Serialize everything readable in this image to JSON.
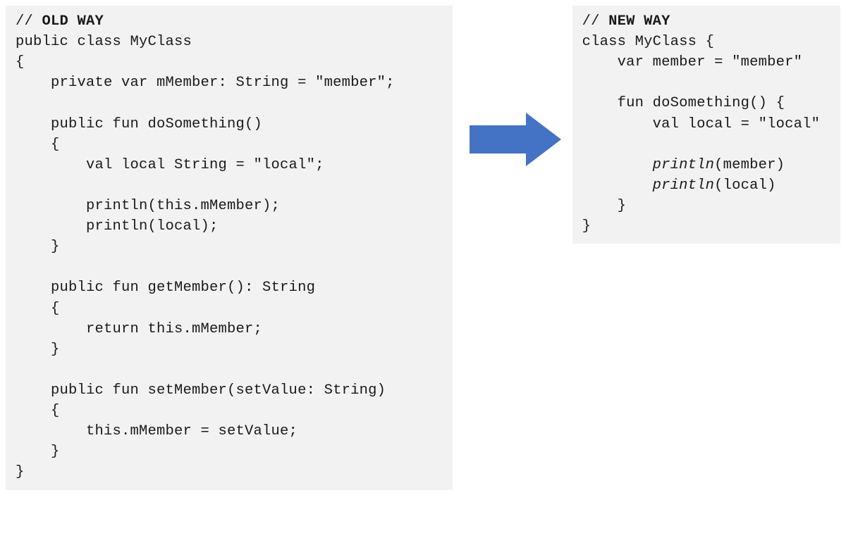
{
  "left": {
    "comment_prefix": "// ",
    "comment_title": "OLD WAY",
    "l1": "public class MyClass",
    "l2": "{",
    "l3": "    private var mMember: String = \"member\";",
    "l4": "",
    "l5": "    public fun doSomething()",
    "l6": "    {",
    "l7": "        val local String = \"local\";",
    "l8": "",
    "l9": "        println(this.mMember);",
    "l10": "        println(local);",
    "l11": "    }",
    "l12": "",
    "l13": "    public fun getMember(): String",
    "l14": "    {",
    "l15": "        return this.mMember;",
    "l16": "    }",
    "l17": "",
    "l18": "    public fun setMember(setValue: String)",
    "l19": "    {",
    "l20": "        this.mMember = setValue;",
    "l21": "    }",
    "l22": "}"
  },
  "right": {
    "comment_prefix": "// ",
    "comment_title": "NEW WAY",
    "r1": "class MyClass {",
    "r2": "    var member = \"member\"",
    "r3": "",
    "r4": "    fun doSomething() {",
    "r5": "        val local = \"local\"",
    "r6": "",
    "r7_pre": "        ",
    "r7_fn": "println",
    "r7_post": "(member)",
    "r8_pre": "        ",
    "r8_fn": "println",
    "r8_post": "(local)",
    "r9": "    }",
    "r10": "}"
  },
  "arrow": {
    "color": "#4472c4"
  }
}
